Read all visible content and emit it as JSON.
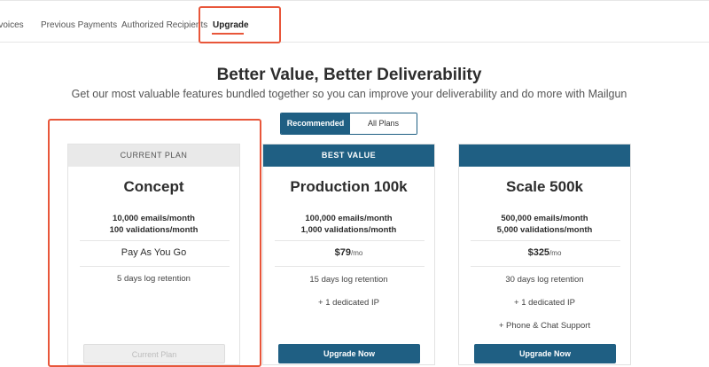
{
  "nav": {
    "items": [
      {
        "label": "Invoices"
      },
      {
        "label": "Previous Payments"
      },
      {
        "label": "Authorized Recipients"
      },
      {
        "label": "Upgrade"
      }
    ]
  },
  "header": {
    "title": "Better Value, Better Deliverability",
    "subtitle": "Get our most valuable features bundled together so you can improve your deliverability and do more with Mailgun"
  },
  "toggle": {
    "recommended": "Recommended",
    "all": "All Plans",
    "selected": "Recommended"
  },
  "plans": [
    {
      "badge": "CURRENT PLAN",
      "name": "Concept",
      "emails": "10,000 emails/month",
      "validations": "100 validations/month",
      "price_text": "Pay As You Go",
      "features": [
        "5 days log retention"
      ],
      "button": "Current Plan"
    },
    {
      "badge": "BEST VALUE",
      "name": "Production 100k",
      "emails": "100,000 emails/month",
      "validations": "1,000 validations/month",
      "price_amount": "$79",
      "price_unit": "/mo",
      "features": [
        "15 days log retention",
        "+ 1 dedicated IP"
      ],
      "button": "Upgrade Now"
    },
    {
      "badge": "",
      "name": "Scale 500k",
      "emails": "500,000 emails/month",
      "validations": "5,000 validations/month",
      "price_amount": "$325",
      "price_unit": "/mo",
      "features": [
        "30 days log retention",
        "+ 1 dedicated IP",
        "+ Phone & Chat Support"
      ],
      "button": "Upgrade Now"
    }
  ],
  "colors": {
    "accent": "#1f5f83",
    "annotation": "#e8563a"
  }
}
